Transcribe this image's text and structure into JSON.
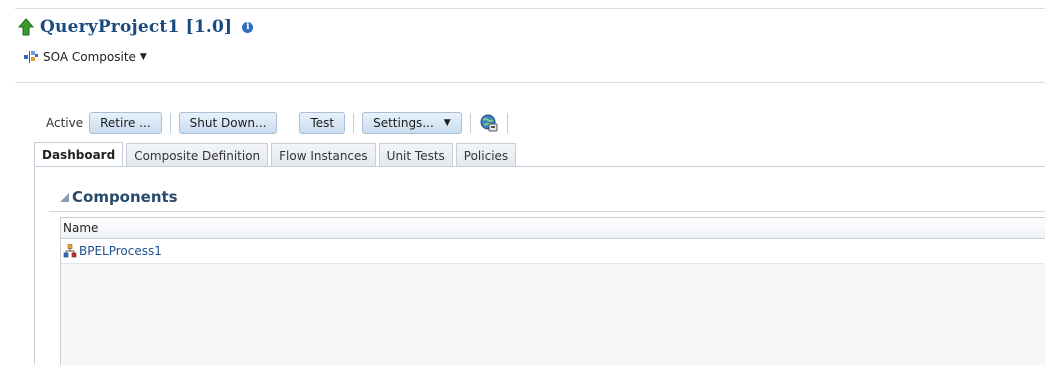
{
  "header": {
    "title": "QueryProject1 [1.0]",
    "info_icon_glyph": "i",
    "subtitle": "SOA Composite"
  },
  "toolbar": {
    "status_label": "Active",
    "retire_label": "Retire ...",
    "shutdown_label": "Shut Down...",
    "test_label": "Test",
    "settings_label": "Settings..."
  },
  "tabs": [
    {
      "label": "Dashboard",
      "active": true
    },
    {
      "label": "Composite Definition",
      "active": false
    },
    {
      "label": "Flow Instances",
      "active": false
    },
    {
      "label": "Unit Tests",
      "active": false
    },
    {
      "label": "Policies",
      "active": false
    }
  ],
  "components": {
    "title": "Components",
    "column_name": "Name",
    "rows": [
      {
        "name": "BPELProcess1",
        "icon": "bpel-process-icon"
      }
    ]
  },
  "colors": {
    "title": "#1a4a80",
    "link": "#1d4f91",
    "button_border": "#a9bfd6",
    "arrow_green": "#3a9a2a"
  }
}
